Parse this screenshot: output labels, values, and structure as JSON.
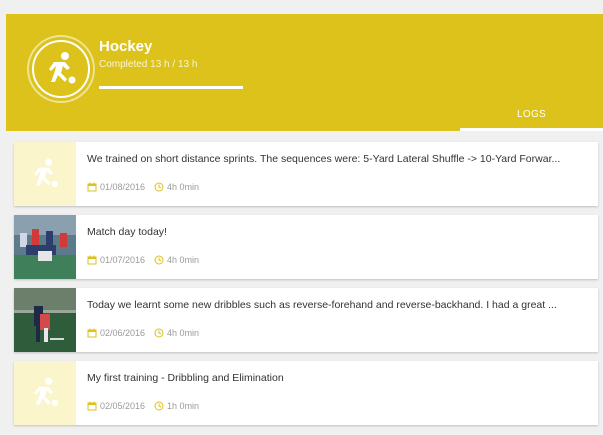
{
  "header": {
    "title": "Hockey",
    "subtitle": "Completed 13 h / 13 h",
    "progress": 1.0,
    "tab_label": "LOGS",
    "accent_color": "#dcc21a",
    "icon": "hockey-player-icon"
  },
  "logs": [
    {
      "text": "We trained on short distance sprints. The sequences were: 5-Yard Lateral Shuffle -> 10-Yard Forwar...",
      "date": "01/08/2016",
      "duration": "4h 0min",
      "thumb": "placeholder"
    },
    {
      "text": "Match day today!",
      "date": "01/07/2016",
      "duration": "4h 0min",
      "thumb": "photo-match"
    },
    {
      "text": "Today we learnt some new dribbles such as reverse-forehand and reverse-backhand. I had a great ...",
      "date": "02/06/2016",
      "duration": "4h 0min",
      "thumb": "photo-dribble"
    },
    {
      "text": "My first training - Dribbling and Elimination",
      "date": "02/05/2016",
      "duration": "1h 0min",
      "thumb": "placeholder"
    }
  ]
}
